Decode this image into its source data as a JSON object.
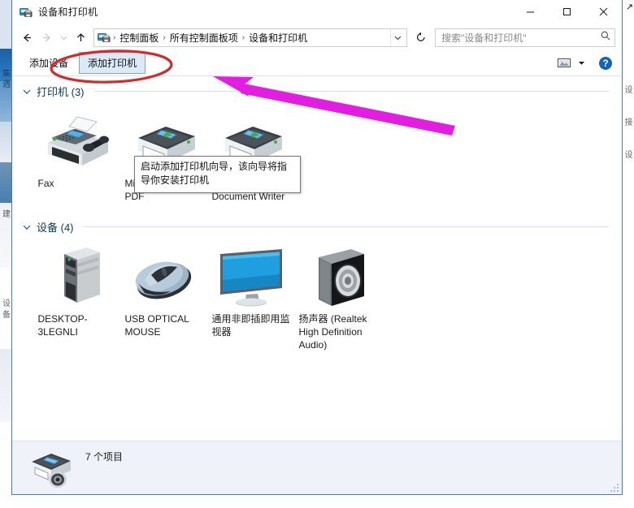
{
  "window": {
    "title": "设备和打印机",
    "title_icon": "devices-and-printers-icon",
    "minimize_label": "最小化",
    "maximize_label": "最大化",
    "close_label": "关闭"
  },
  "address_bar": {
    "back_label": "后退",
    "forward_label": "前进",
    "recent_label": "最近浏览的位置",
    "up_label": "上移一级",
    "breadcrumbs": [
      "控制面板",
      "所有控制面板项",
      "设备和打印机"
    ],
    "separator": "›",
    "dropdown_label": "历史记录",
    "refresh_label": "刷新",
    "refresh_glyph": "↻"
  },
  "search": {
    "placeholder": "搜索\"设备和打印机\"",
    "value": "",
    "icon": "search-icon"
  },
  "command_bar": {
    "items": [
      {
        "label": "添加设备",
        "hover": false
      },
      {
        "label": "添加打印机",
        "hover": true
      }
    ],
    "view_icon": "view-options-icon",
    "caret_icon": "chevron-down-icon",
    "help_icon": "help-icon",
    "help_glyph": "?"
  },
  "tooltip": {
    "visible": true,
    "text": "启动添加打印机向导，该向导将指导你安装打印机"
  },
  "sections": [
    {
      "id": "printers",
      "title": "打印机 (3)",
      "expanded": true,
      "items": [
        {
          "label": "Fax",
          "icon": "fax-machine-icon"
        },
        {
          "label": "Microsoft Print to PDF",
          "icon": "printer-icon"
        },
        {
          "label": "Microsoft XPS Document Writer",
          "icon": "printer-icon"
        }
      ]
    },
    {
      "id": "devices",
      "title": "设备 (4)",
      "expanded": true,
      "items": [
        {
          "label": "DESKTOP-3LEGNLI",
          "icon": "desktop-tower-icon"
        },
        {
          "label": "USB OPTICAL MOUSE",
          "icon": "mouse-icon"
        },
        {
          "label": "通用非即插即用监视器",
          "icon": "monitor-icon"
        },
        {
          "label": "扬声器 (Realtek High Definition Audio)",
          "icon": "speaker-icon"
        }
      ]
    }
  ],
  "status_bar": {
    "text": "7 个项目",
    "icon": "multifunction-printer-icon"
  },
  "annotations": {
    "ellipse": {
      "color": "#d42a2a",
      "label": "red-highlight-ellipse"
    },
    "arrow": {
      "color": "#e21ee0",
      "label": "magenta-pointer-arrow"
    }
  },
  "background": {
    "left_glyphs": "集遇",
    "left_glyphs2": "建",
    "left_glyphs3": "设备",
    "right_glyphs": "设接设"
  },
  "colors": {
    "window_border": "#4a7db5",
    "section_title": "#0a3a5c",
    "hover_bg": "#dce9f7",
    "hover_border": "#7aa7d4",
    "status_bg": "#eff2f9",
    "help_blue": "#1464b4"
  }
}
